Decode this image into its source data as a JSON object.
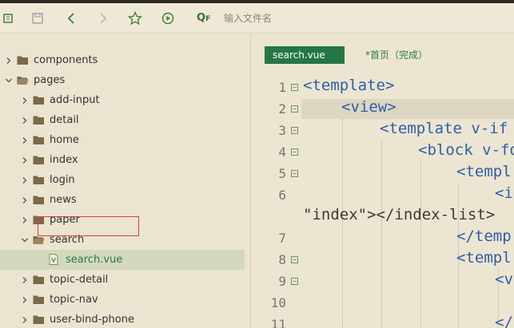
{
  "toolbar": {
    "search_label": "Q",
    "search_label_sub": "F",
    "search_placeholder": "输入文件名"
  },
  "sidebar": {
    "items": [
      {
        "label": "components",
        "indent": 0,
        "expanded": false,
        "type": "folder"
      },
      {
        "label": "pages",
        "indent": 0,
        "expanded": true,
        "type": "folder"
      },
      {
        "label": "add-input",
        "indent": 1,
        "expanded": false,
        "type": "folder"
      },
      {
        "label": "detail",
        "indent": 1,
        "expanded": false,
        "type": "folder"
      },
      {
        "label": "home",
        "indent": 1,
        "expanded": false,
        "type": "folder"
      },
      {
        "label": "index",
        "indent": 1,
        "expanded": false,
        "type": "folder"
      },
      {
        "label": "login",
        "indent": 1,
        "expanded": false,
        "type": "folder"
      },
      {
        "label": "news",
        "indent": 1,
        "expanded": false,
        "type": "folder"
      },
      {
        "label": "paper",
        "indent": 1,
        "expanded": false,
        "type": "folder"
      },
      {
        "label": "search",
        "indent": 1,
        "expanded": true,
        "type": "folder"
      },
      {
        "label": "search.vue",
        "indent": 2,
        "expanded": false,
        "type": "file",
        "selected": true
      },
      {
        "label": "topic-detail",
        "indent": 1,
        "expanded": false,
        "type": "folder"
      },
      {
        "label": "topic-nav",
        "indent": 1,
        "expanded": false,
        "type": "folder"
      },
      {
        "label": "user-bind-phone",
        "indent": 1,
        "expanded": false,
        "type": "folder"
      }
    ]
  },
  "editor": {
    "tabs": [
      {
        "label": "search.vue",
        "active": true
      },
      {
        "label": "*首页（完成）",
        "active": false
      }
    ],
    "lines": [
      {
        "num": "1",
        "fold": true,
        "text": "<template>"
      },
      {
        "num": "2",
        "fold": true,
        "text": "<view>"
      },
      {
        "num": "3",
        "fold": true,
        "text": "<template v-if"
      },
      {
        "num": "4",
        "fold": true,
        "text": "<block v-fo"
      },
      {
        "num": "5",
        "fold": true,
        "text": "<templ"
      },
      {
        "num": "6",
        "fold": false,
        "text": "<i"
      },
      {
        "num": "",
        "fold": false,
        "text": "\"index\"></index-list>"
      },
      {
        "num": "7",
        "fold": false,
        "text": "</temp"
      },
      {
        "num": "8",
        "fold": true,
        "text": "<templ"
      },
      {
        "num": "9",
        "fold": true,
        "text": "<v"
      },
      {
        "num": "10",
        "fold": false,
        "text": ""
      },
      {
        "num": "11",
        "fold": false,
        "text": "</"
      }
    ]
  },
  "colors": {
    "tab_active": "#247744",
    "selection_border": "#e03a3a",
    "tag_text": "#2f5ea8"
  }
}
